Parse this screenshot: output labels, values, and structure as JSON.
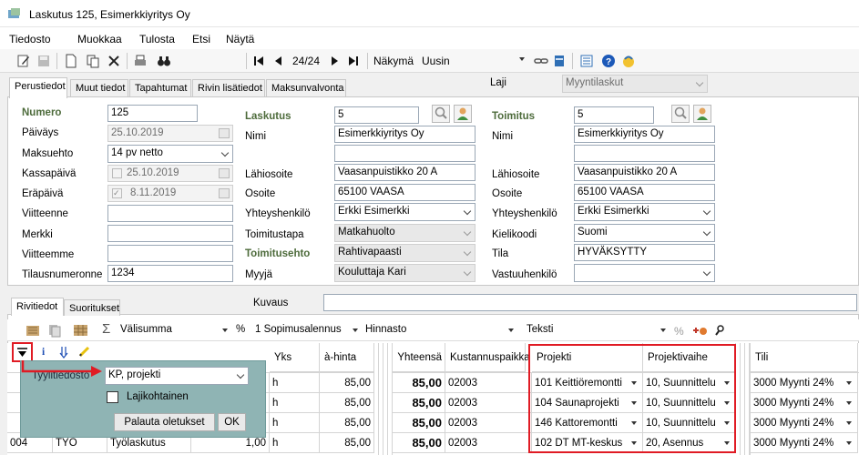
{
  "window": {
    "title": "Laskutus 125, Esimerkkiyritys Oy"
  },
  "menu": [
    "Tiedosto",
    "Muokkaa",
    "Tulosta",
    "Etsi",
    "Näytä"
  ],
  "toolbar": {
    "record_position": "24/24",
    "view_label": "Näkymä",
    "view_value": "Uusin"
  },
  "tabs": [
    "Perustiedot",
    "Muut tiedot",
    "Tapahtumat",
    "Rivin lisätiedot",
    "Maksunvalvonta"
  ],
  "laji": {
    "label": "Laji",
    "value": "Myyntilaskut"
  },
  "left_fields": {
    "numero_label": "Numero",
    "numero": "125",
    "paivays_label": "Päiväys",
    "paivays": "25.10.2019",
    "maksuehto_label": "Maksuehto",
    "maksuehto": "14 pv netto",
    "kassapaiva_label": "Kassapäivä",
    "kassapaiva": "25.10.2019",
    "erapaiva_label": "Eräpäivä",
    "erapaiva": "8.11.2019",
    "viitteenne_label": "Viitteenne",
    "merkki_label": "Merkki",
    "viitteemme_label": "Viitteemme",
    "tilausnumero_label": "Tilausnumeronne",
    "tilausnumero": "1234"
  },
  "laskutus": {
    "header": "Laskutus",
    "number": "5",
    "nimi_label": "Nimi",
    "nimi": "Esimerkkiyritys Oy",
    "lahiosoite_label": "Lähiosoite",
    "lahiosoite": "Vaasanpuistikko 20 A",
    "osoite_label": "Osoite",
    "osoite": "65100  VAASA",
    "yhteyshenkilo_label": "Yhteyshenkilö",
    "yhteyshenkilo": "Erkki Esimerkki",
    "toimitustapa_label": "Toimitustapa",
    "toimitustapa": "Matkahuolto",
    "toimitusehto_label": "Toimitusehto",
    "toimitusehto": "Rahtivapaasti",
    "myyja_label": "Myyjä",
    "myyja": "Kouluttaja Kari"
  },
  "toimitus": {
    "header": "Toimitus",
    "number": "5",
    "nimi_label": "Nimi",
    "nimi": "Esimerkkiyritys Oy",
    "lahiosoite_label": "Lähiosoite",
    "lahiosoite": "Vaasanpuistikko 20 A",
    "osoite_label": "Osoite",
    "osoite": "65100  VAASA",
    "yhteyshenkilo_label": "Yhteyshenkilö",
    "yhteyshenkilo": "Erkki Esimerkki",
    "kielikoodi_label": "Kielikoodi",
    "kielikoodi": "Suomi",
    "tila_label": "Tila",
    "tila": "HYVÄKSYTTY",
    "vastuuhenkilo_label": "Vastuuhenkilö"
  },
  "lower_tabs": [
    "Rivitiedot",
    "Suoritukset"
  ],
  "kuvaus_label": "Kuvaus",
  "grid_toolbar": {
    "sum_label": "Välisumma",
    "discount": "1 Sopimusalennus",
    "hinnasto": "Hinnasto",
    "teksti": "Teksti",
    "percent": "%",
    "sigma": "Σ"
  },
  "grid": {
    "columns": [
      "Yks",
      "à-hinta",
      "Yhteensä",
      "Kustannuspaikka",
      "Projekti",
      "Projektivaihe",
      "Tili"
    ],
    "rows": [
      {
        "no": "",
        "code": "",
        "name": "",
        "qty": "",
        "unit": "h",
        "price": "85,00",
        "total": "85,00",
        "cost": "02003",
        "project": "101 Keittiöremontti",
        "phase": "10, Suunnittelu",
        "account": "3000 Myynti 24%"
      },
      {
        "no": "",
        "code": "",
        "name": "",
        "qty": "",
        "unit": "h",
        "price": "85,00",
        "total": "85,00",
        "cost": "02003",
        "project": "104 Saunaprojekti",
        "phase": "10, Suunnittelu",
        "account": "3000 Myynti 24%"
      },
      {
        "no": "",
        "code": "",
        "name": "",
        "qty": "",
        "unit": "h",
        "price": "85,00",
        "total": "85,00",
        "cost": "02003",
        "project": "146 Kattoremontti",
        "phase": "10, Suunnittelu",
        "account": "3000 Myynti 24%"
      },
      {
        "no": "004",
        "code": "TYO",
        "name": "Työlaskutus",
        "qty": "1,00",
        "unit": "h",
        "price": "85,00",
        "total": "85,00",
        "cost": "02003",
        "project": "102 DT MT-keskus",
        "phase": "20, Asennus",
        "account": "3000 Myynti 24%"
      }
    ]
  },
  "popup": {
    "label": "Tyylitiedosto",
    "value": "KP, projekti",
    "checkbox_label": "Lajikohtainen",
    "reset_button": "Palauta oletukset",
    "ok_button": "OK"
  },
  "colors": {
    "highlight": "#e01b24",
    "popup_bg": "#8fb4b4",
    "label_green": "#4d6b3b"
  }
}
